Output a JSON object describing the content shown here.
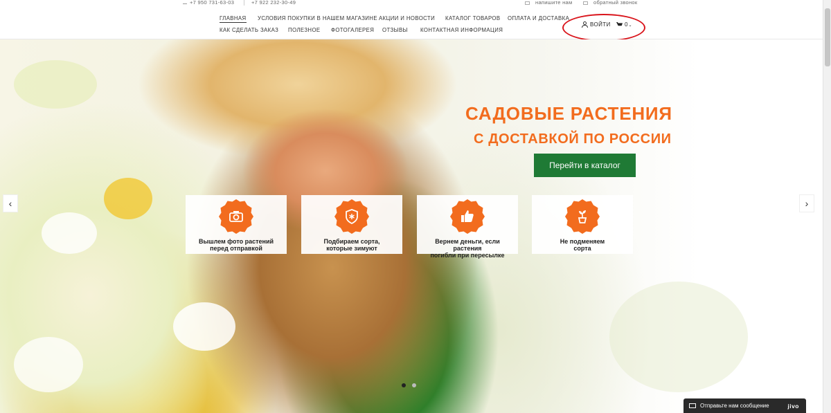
{
  "topbar": {
    "phone1": "+7 950 731-63-03",
    "phone2": "+7 922 232-30-49",
    "write_us": "напишите нам",
    "callback": "обратный звонок"
  },
  "nav": {
    "row1": [
      "Главная",
      "Условия покупки в нашем магазине",
      "Акции и новости",
      "Каталог товаров",
      "Оплата и доставка"
    ],
    "row2": [
      "Как сделать заказ",
      "Полезное",
      "Фотогалерея",
      "Отзывы",
      "Контактная информация"
    ],
    "login": "Войти",
    "cart_count": "0"
  },
  "hero": {
    "title": "САДОВЫЕ РАСТЕНИЯ",
    "subtitle": "С ДОСТАВКОЙ ПО РОССИИ",
    "cta": "Перейти в каталог",
    "features": [
      {
        "icon": "camera-icon",
        "line1": "Вышлем фото растений",
        "line2": "перед отправкой"
      },
      {
        "icon": "snowflake-shield-icon",
        "line1": "Подбираем сорта,",
        "line2": "которые зимуют"
      },
      {
        "icon": "thumbs-up-icon",
        "line1": "Вернем деньги, если растения",
        "line2": "погибли при пересылке"
      },
      {
        "icon": "potted-plant-icon",
        "line1": "Не подменяем",
        "line2": "сорта"
      }
    ],
    "prev_arrow": "‹",
    "next_arrow": "›"
  },
  "chat": {
    "label": "Отправьте нам сообщение",
    "brand": "jivo"
  },
  "colors": {
    "accent": "#f26c1e",
    "cta": "#1f7a35",
    "annotation": "#d9141b"
  }
}
